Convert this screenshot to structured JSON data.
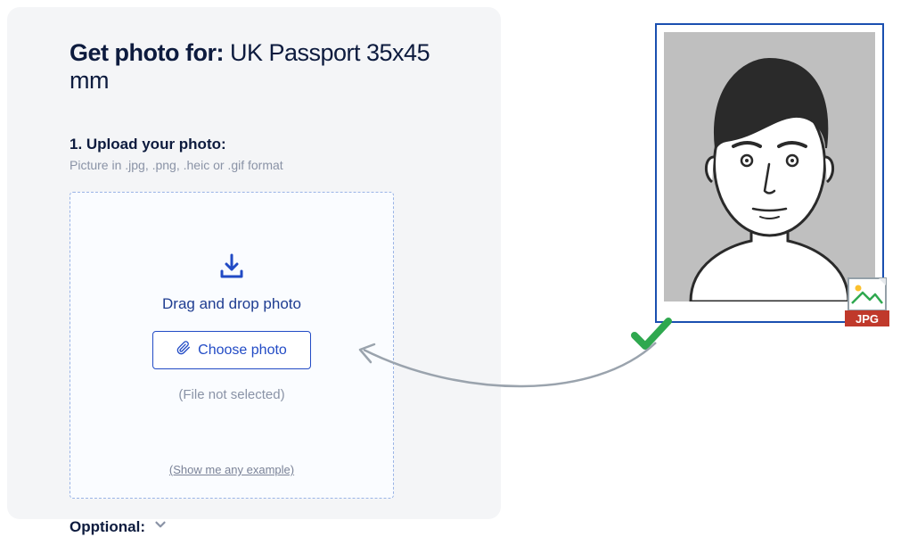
{
  "title": {
    "prefix": "Get photo for: ",
    "subject": "UK Passport 35x45 mm"
  },
  "step1": {
    "label": "1. Upload your photo:",
    "hint": "Picture in .jpg, .png, .heic or .gif format"
  },
  "dropzone": {
    "drop_text": "Drag and drop photo",
    "choose_label": "Choose photo",
    "file_status": "(File not selected)",
    "example_link": "(Show me any example)"
  },
  "optional": {
    "label": "Opptional:"
  },
  "preview": {
    "format_badge": "JPG"
  }
}
